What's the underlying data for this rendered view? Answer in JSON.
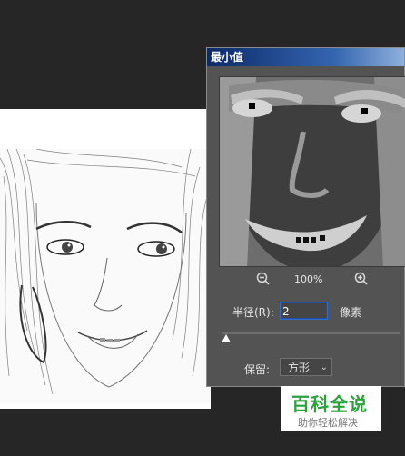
{
  "dialog": {
    "title": "最小值",
    "zoom": {
      "level": "100%"
    },
    "radius": {
      "label": "半径(R):",
      "value": "2",
      "unit": "像素",
      "slider_fraction": 0.02
    },
    "preserve": {
      "label": "保留:",
      "selected": "方形"
    }
  },
  "watermark": {
    "title": "百科全说",
    "subtitle": "助你轻松解决"
  },
  "colors": {
    "titlebar_start": "#0b2a6a",
    "titlebar_end": "#8fb0dc",
    "panel": "#535353",
    "watermark_green": "#2aa33a"
  },
  "icons": [
    "zoom-out-icon",
    "zoom-in-icon",
    "chevron-down-icon",
    "slider-thumb-icon"
  ]
}
